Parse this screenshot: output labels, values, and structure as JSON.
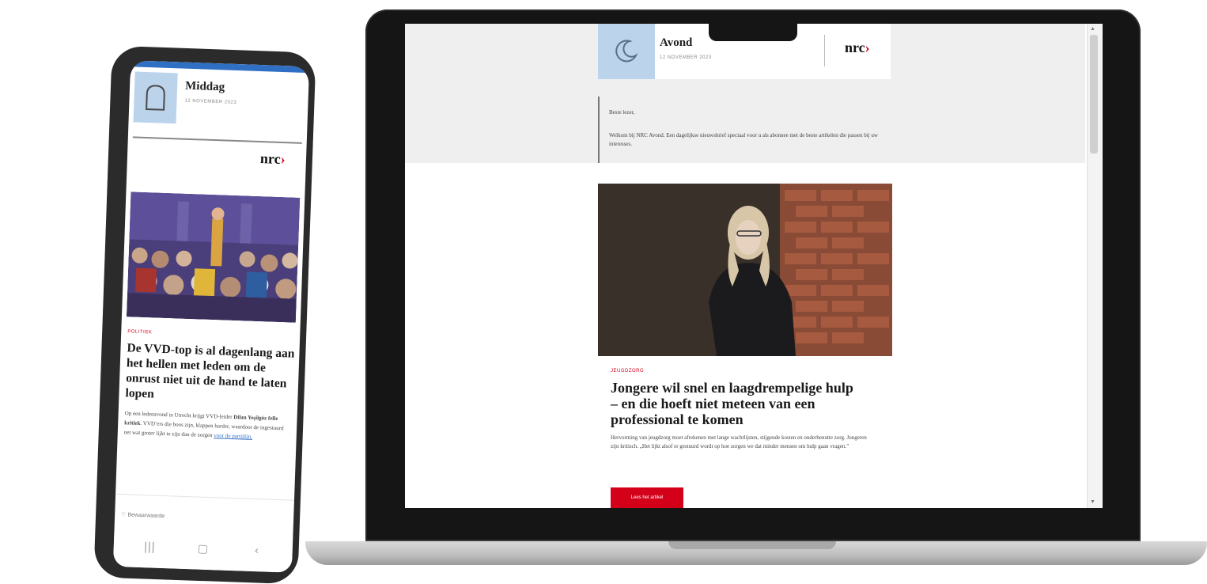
{
  "laptop_newsletter": {
    "edition_title": "Avond",
    "edition_date": "12 NOVEMBER 2023",
    "logo_text": "nrc",
    "logo_chevron": "›",
    "greeting": "Beste lezer,",
    "intro": "Welkom bij NRC Avond. Een dagelijkse nieuwsbrief speciaal voor u als abonnee met de beste artikelen die passen bij uw interesses.",
    "kicker": "JEUGDZORG",
    "headline": "Jongere wil snel en laagdrempelige hulp – en die hoeft niet meteen van een professional te komen",
    "lead": "Hervorming van jeugdzorg moet afrekenen met lange wachtlijsten, stijgende kosten en onderbenutte zorg. Jongeren zijn kritisch. „Het lijkt alsof er gestuurd wordt op hoe zorgen we dat minder mensen om hulp gaan vragen.”",
    "read_button": "Lees het artikel",
    "scroll_up": "▲",
    "scroll_down": "▼"
  },
  "phone_newsletter": {
    "edition_title": "Middag",
    "edition_date": "12 NOVEMBER 2023",
    "logo_text": "nrc",
    "logo_chevron": "›",
    "kicker": "POLITIEK",
    "headline": "De VVD-top is al dagenlang aan het hellen met leden om de onrust niet uit de hand te laten lopen",
    "lead_part1": "Op een ledenavond in Utrecht krijgt VVD-leider ",
    "lead_bold": "Dilan Yeşilgöz felle kritiek",
    "lead_part2": ". VVD’ers die boos zijn, klappen harder, waardoor de ingestuurd net wat groter lijkt te zijn dan de zorgen ",
    "lead_link": "voor de partijlijn.",
    "bookmark_label": "♡  Bewaarwaarde",
    "nav_recent": "|||",
    "nav_home": "▢",
    "nav_back": "‹"
  },
  "colors": {
    "accent_red": "#d4001a",
    "edition_blue": "#bcd3ec",
    "top_bar_blue": "#2f6fc4"
  },
  "icons": {
    "laptop_edition_icon": "moon-icon",
    "phone_edition_icon": "bread-icon"
  }
}
